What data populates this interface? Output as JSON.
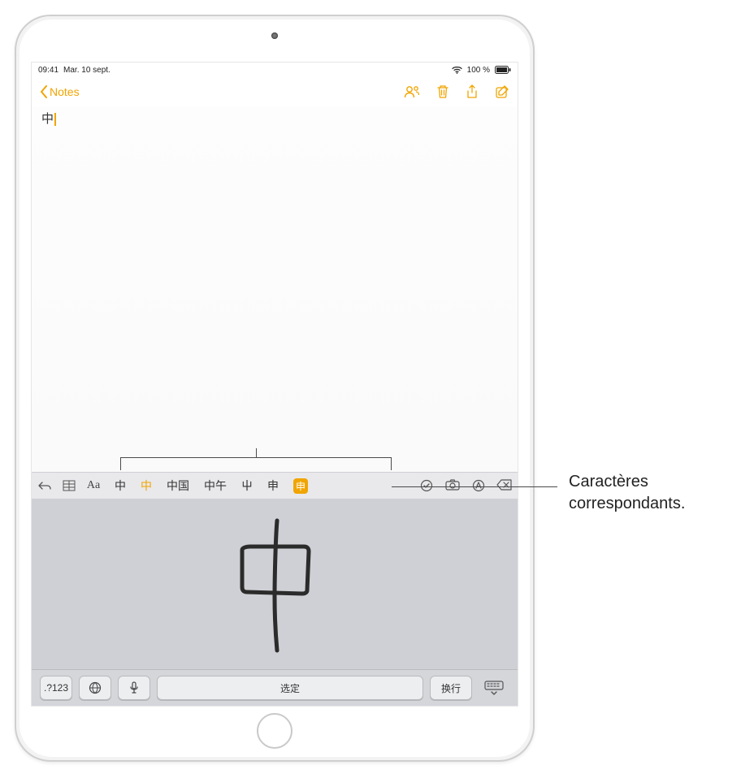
{
  "status": {
    "time": "09:41",
    "date": "Mar. 10 sept.",
    "battery": "100 %"
  },
  "nav": {
    "back_label": "Notes"
  },
  "note": {
    "typed_char": "中"
  },
  "toolbar": {
    "format_label": "Aa"
  },
  "candidates": {
    "c0": "中",
    "c1": "中",
    "c2": "中国",
    "c3": "中午",
    "c4": "屮",
    "c5": "申",
    "c6": "申"
  },
  "keyboard": {
    "mode_label": ".?123",
    "space_label": "选定",
    "return_label": "换行"
  },
  "callout": {
    "line1": "Caractères",
    "line2": "correspondants."
  }
}
